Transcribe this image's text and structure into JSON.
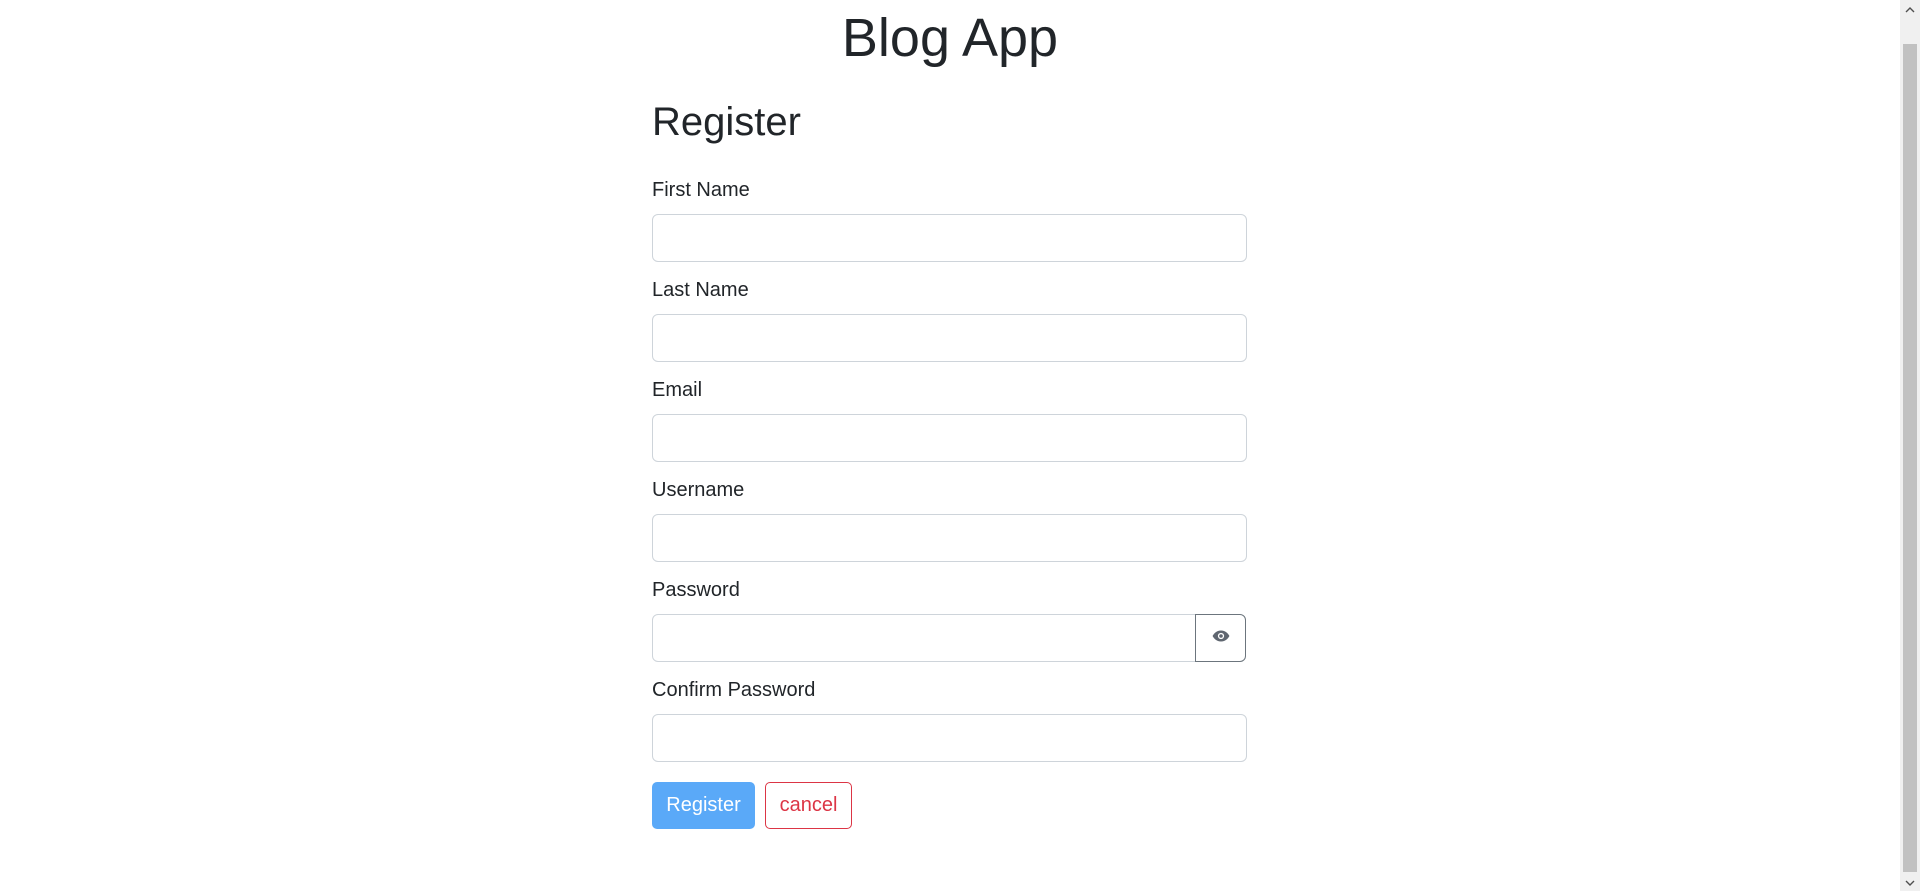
{
  "app": {
    "title": "Blog App"
  },
  "form": {
    "heading": "Register",
    "fields": {
      "first_name": {
        "label": "First Name",
        "value": "",
        "placeholder": ""
      },
      "last_name": {
        "label": "Last Name",
        "value": "",
        "placeholder": ""
      },
      "email": {
        "label": "Email",
        "value": "",
        "placeholder": ""
      },
      "username": {
        "label": "Username",
        "value": "",
        "placeholder": ""
      },
      "password": {
        "label": "Password",
        "value": "",
        "placeholder": ""
      },
      "confirm_password": {
        "label": "Confirm Password",
        "value": "",
        "placeholder": ""
      }
    },
    "buttons": {
      "register": "Register",
      "cancel": "cancel"
    }
  },
  "icons": {
    "password_toggle": "eye-icon",
    "scroll_up": "chevron-up-icon",
    "scroll_down": "chevron-down-icon"
  },
  "colors": {
    "primary": "#5aa9f8",
    "danger": "#dc3545",
    "text": "#212529",
    "border": "#ced4da"
  }
}
